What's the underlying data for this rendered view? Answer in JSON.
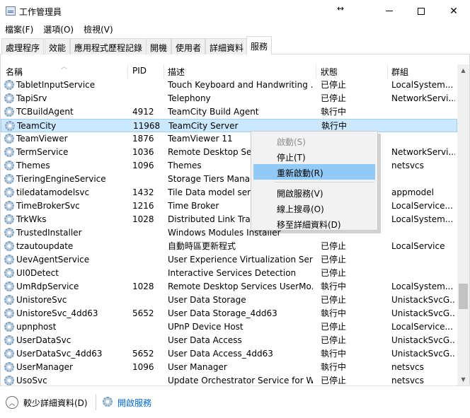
{
  "window": {
    "title": "工作管理員",
    "move_glyph": "↔",
    "close_glyph": "✕"
  },
  "menu": [
    "檔案(F)",
    "選項(O)",
    "檢視(V)"
  ],
  "tabs": [
    "處理程序",
    "效能",
    "應用程式歷程記錄",
    "開機",
    "使用者",
    "詳細資料",
    "服務"
  ],
  "active_tab": "服務",
  "columns": {
    "name": "名稱",
    "pid": "PID",
    "desc": "描述",
    "status": "狀態",
    "group": "群組"
  },
  "rows": [
    {
      "name": "TabletInputService",
      "pid": "",
      "desc": "Touch Keyboard and Handwriting ...",
      "status": "已停止",
      "group": "LocalSystem..."
    },
    {
      "name": "TapiSrv",
      "pid": "",
      "desc": "Telephony",
      "status": "已停止",
      "group": "NetworkServi..."
    },
    {
      "name": "TCBuildAgent",
      "pid": "4912",
      "desc": "TeamCity Build Agent",
      "status": "執行中",
      "group": ""
    },
    {
      "name": "TeamCity",
      "pid": "11968",
      "desc": "TeamCity Server",
      "status": "執行中",
      "group": ""
    },
    {
      "name": "TeamViewer",
      "pid": "1876",
      "desc": "TeamViewer 11",
      "status": "",
      "group": ""
    },
    {
      "name": "TermService",
      "pid": "1036",
      "desc": "Remote Desktop Serv",
      "status": "",
      "group": "NetworkServi..."
    },
    {
      "name": "Themes",
      "pid": "1096",
      "desc": "Themes",
      "status": "",
      "group": "netsvcs"
    },
    {
      "name": "TieringEngineService",
      "pid": "",
      "desc": "Storage Tiers Manag",
      "status": "",
      "group": ""
    },
    {
      "name": "tiledatamodelsvc",
      "pid": "1432",
      "desc": "Tile Data model serve",
      "status": "",
      "group": "appmodel"
    },
    {
      "name": "TimeBrokerSvc",
      "pid": "1216",
      "desc": "Time Broker",
      "status": "",
      "group": "LocalService..."
    },
    {
      "name": "TrkWks",
      "pid": "1028",
      "desc": "Distributed Link Track",
      "status": "",
      "group": "LocalSystem..."
    },
    {
      "name": "TrustedInstaller",
      "pid": "",
      "desc": "Windows Modules Installer",
      "status": "",
      "group": ""
    },
    {
      "name": "tzautoupdate",
      "pid": "",
      "desc": "自動時區更新程式",
      "status": "已停止",
      "group": "LocalService"
    },
    {
      "name": "UevAgentService",
      "pid": "",
      "desc": "User Experience Virtualization Ser...",
      "status": "已停止",
      "group": ""
    },
    {
      "name": "UI0Detect",
      "pid": "",
      "desc": "Interactive Services Detection",
      "status": "已停止",
      "group": ""
    },
    {
      "name": "UmRdpService",
      "pid": "1028",
      "desc": "Remote Desktop Services UserMo...",
      "status": "執行中",
      "group": "LocalSystem..."
    },
    {
      "name": "UnistoreSvc",
      "pid": "",
      "desc": "User Data Storage",
      "status": "已停止",
      "group": "UnistackSvcG..."
    },
    {
      "name": "UnistoreSvc_4dd63",
      "pid": "5652",
      "desc": "User Data Storage_4dd63",
      "status": "執行中",
      "group": "UnistackSvcG..."
    },
    {
      "name": "upnphost",
      "pid": "",
      "desc": "UPnP Device Host",
      "status": "已停止",
      "group": "LocalService..."
    },
    {
      "name": "UserDataSvc",
      "pid": "",
      "desc": "User Data Access",
      "status": "已停止",
      "group": "UnistackSvcG..."
    },
    {
      "name": "UserDataSvc_4dd63",
      "pid": "5652",
      "desc": "User Data Access_4dd63",
      "status": "執行中",
      "group": "UnistackSvcG..."
    },
    {
      "name": "UserManager",
      "pid": "1096",
      "desc": "User Manager",
      "status": "執行中",
      "group": "netsvcs"
    },
    {
      "name": "UsoSvc",
      "pid": "",
      "desc": "Update Orchestrator Service for W...",
      "status": "已停止",
      "group": "netsvcs"
    }
  ],
  "selected_row": "TeamCity",
  "context_menu": {
    "start": "啟動(S)",
    "stop": "停止(T)",
    "restart": "重新啟動(R)",
    "open_services": "開啟服務(V)",
    "search_online": "線上搜尋(O)",
    "go_to_details": "移至詳細資料(D)"
  },
  "footer": {
    "fewer_details": "較少詳細資料(D)",
    "open_services": "開啟服務"
  },
  "colors": {
    "selection": "#cce8ff",
    "menu_highlight": "#91c9f7",
    "link": "#0066cc"
  }
}
